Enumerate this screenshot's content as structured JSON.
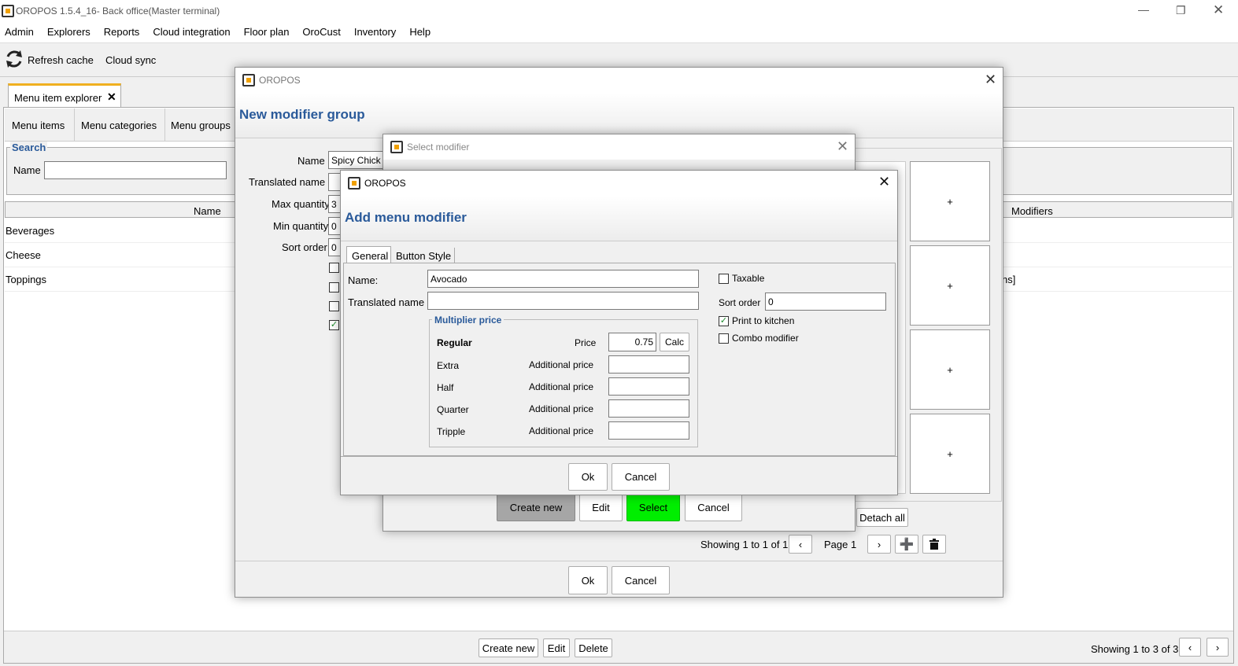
{
  "window": {
    "title": "OROPOS 1.5.4_16- Back office(Master terminal)"
  },
  "menubar": [
    "Admin",
    "Explorers",
    "Reports",
    "Cloud integration",
    "Floor plan",
    "OroCust",
    "Inventory",
    "Help"
  ],
  "toolbar": {
    "refresh": "Refresh cache",
    "cloud_sync": "Cloud sync"
  },
  "explorer": {
    "tab": "Menu item explorer",
    "subtabs": [
      "Menu items",
      "Menu categories",
      "Menu groups"
    ],
    "search_label": "Search",
    "name_label": "Name",
    "column_name": "Name",
    "column_modifiers": "Modifiers",
    "rows": [
      "Beverages",
      "Cheese",
      "Toppings"
    ],
    "row_modifiers_fragment": "ns]",
    "create_new": "Create new",
    "edit": "Edit",
    "delete": "Delete",
    "showing": "Showing 1 to 3 of 3"
  },
  "group_dialog": {
    "title": "OROPOS",
    "heading": "New modifier group",
    "name_label": "Name",
    "name_value": "Spicy Chick",
    "translated_label": "Translated name",
    "max_label": "Max quantity",
    "max_value": "3",
    "min_label": "Min quantity",
    "min_value": "0",
    "sort_label": "Sort order",
    "sort_value": "0",
    "plus": "+",
    "detach_all": "Detach all",
    "showing": "Showing 1 to 1 of 1",
    "page": "Page 1",
    "ok": "Ok",
    "cancel": "Cancel"
  },
  "select_dialog": {
    "title": "Select modifier",
    "create_new": "Create new",
    "edit": "Edit",
    "select": "Select",
    "cancel": "Cancel"
  },
  "add_dialog": {
    "title": "OROPOS",
    "heading": "Add menu modifier",
    "tabs": [
      "General",
      "Button Style"
    ],
    "name_label": "Name:",
    "name_value": "Avocado",
    "translated_label": "Translated name",
    "multiplier_legend": "Multiplier price",
    "regular": "Regular",
    "price_label": "Price",
    "price_value": "0.75",
    "calc": "Calc",
    "rows": [
      {
        "name": "Extra",
        "label": "Additional price"
      },
      {
        "name": "Half",
        "label": "Additional price"
      },
      {
        "name": "Quarter",
        "label": "Additional price"
      },
      {
        "name": "Tripple",
        "label": "Additional price"
      }
    ],
    "taxable": "Taxable",
    "sort_label": "Sort order",
    "sort_value": "0",
    "print_kitchen": "Print to kitchen",
    "combo": "Combo modifier",
    "ok": "Ok",
    "cancel": "Cancel"
  },
  "colors": {
    "accent": "#2a5a9a",
    "select_green": "#00ee00",
    "tab_highlight": "#f0b020"
  }
}
